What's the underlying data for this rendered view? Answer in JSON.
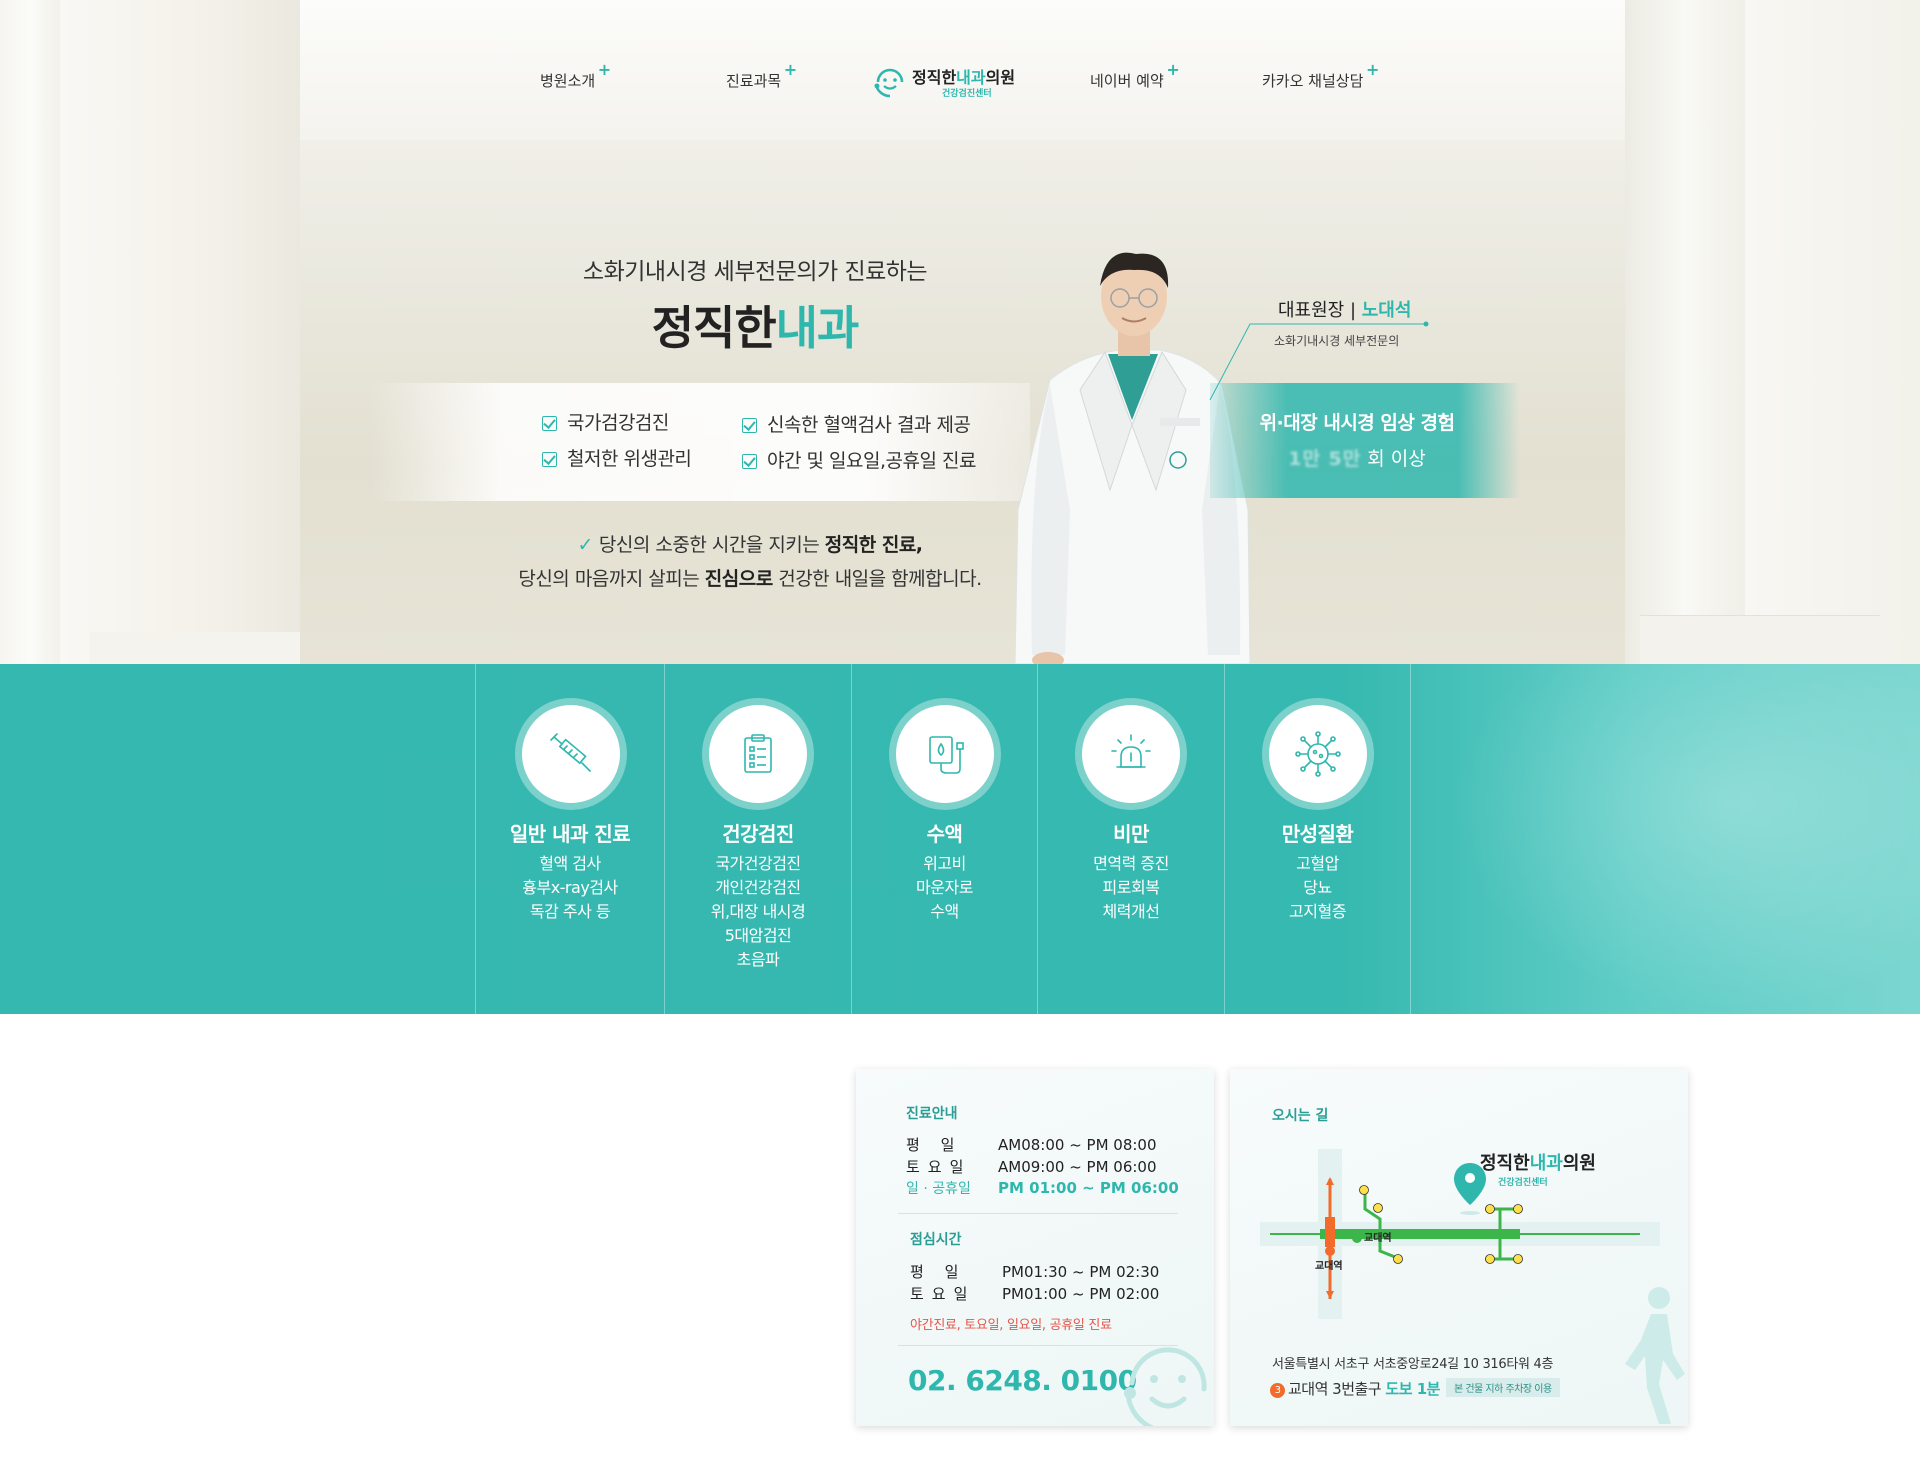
{
  "nav": {
    "items": [
      {
        "label": "병원소개"
      },
      {
        "label": "진료과목"
      },
      {
        "label": "네이버 예약"
      },
      {
        "label": "카카오 채널상담"
      }
    ],
    "plus": "+",
    "logo": {
      "name_main": "정직한",
      "name_accent": "내과",
      "name_tail": "의원",
      "sub": "건강검진센터"
    }
  },
  "hero": {
    "subtitle": "소화기내시경 세부전문의가 진료하는",
    "title_main": "정직한",
    "title_accent": "내과",
    "features": [
      "국가검강검진",
      "신속한 혈액검사 결과 제공",
      "철저한 위생관리",
      "야간 및 일요일,공휴일 진료"
    ],
    "quote_tick": "✓",
    "quote1_pre": "당신의 소중한 시간을 지키는 ",
    "quote1_bold": "정직한 진료,",
    "quote2_pre": "당신의 마음까지 살피는 ",
    "quote2_bold": "진심으로",
    "quote2_post": " 건강한 내일을 함께합니다.",
    "doctor_role": "대표원장 | ",
    "doctor_name": "노대석",
    "doctor_desc": "소화기내시경 세부전문의",
    "experience_line1": "위·대장 내시경 임상 경험",
    "experience_blur": "1만 5만",
    "experience_suffix": "회 이상"
  },
  "services": [
    {
      "icon": "syringe-icon",
      "title": "일반 내과 진료",
      "lines": [
        "혈액 검사",
        "흉부x-ray검사",
        "독감 주사 등"
      ]
    },
    {
      "icon": "clipboard-icon",
      "title": "건강검진",
      "lines": [
        "국가건강검진",
        "개인건강검진",
        "위,대장 내시경",
        "5대암검진",
        "초음파"
      ]
    },
    {
      "icon": "iv-drip-icon",
      "title": "수액",
      "lines": [
        "위고비",
        "마운자로",
        "수액"
      ]
    },
    {
      "icon": "scale-alarm-icon",
      "title": "비만",
      "lines": [
        "면역력 증진",
        "피로회복",
        "체력개선"
      ]
    },
    {
      "icon": "virus-icon",
      "title": "만성질환",
      "lines": [
        "고혈압",
        "당뇨",
        "고지혈증"
      ]
    }
  ],
  "hours": {
    "heading": "진료안내",
    "rows": [
      {
        "day": "평  일",
        "time": "AM08:00 ~ PM 08:00"
      },
      {
        "day": "토요일",
        "time": "AM09:00 ~ PM 06:00"
      },
      {
        "day": "일 · 공휴일",
        "time": "PM 01:00 ~ PM 06:00"
      }
    ],
    "lunch_heading": "점심시간",
    "lunch_rows": [
      {
        "day": "평  일",
        "time": "PM01:30 ~ PM 02:30"
      },
      {
        "day": "토요일",
        "time": "PM01:00 ~ PM 02:00"
      }
    ],
    "note": "야간진료, 토요일, 일요일, 공휴일 진료",
    "phone": "02. 6248. 0100"
  },
  "map": {
    "heading": "오시는 길",
    "clinic_main": "정직한",
    "clinic_accent": "내과",
    "clinic_tail": "의원",
    "clinic_sub": "건강검진센터",
    "station_label_1": "교대역",
    "station_label_2": "교대역",
    "address": "서울특별시 서초구 서초중앙로24길 10 316타워 4층",
    "exit_num": "3",
    "exit_text": "교대역 3번출구 ",
    "exit_walk": "도보 1분",
    "parking": "본 건물 지하 주차장 이용",
    "colors": {
      "line2": "#3cb54a",
      "line3": "#f26b2a",
      "accent": "#2fb7ae"
    }
  }
}
